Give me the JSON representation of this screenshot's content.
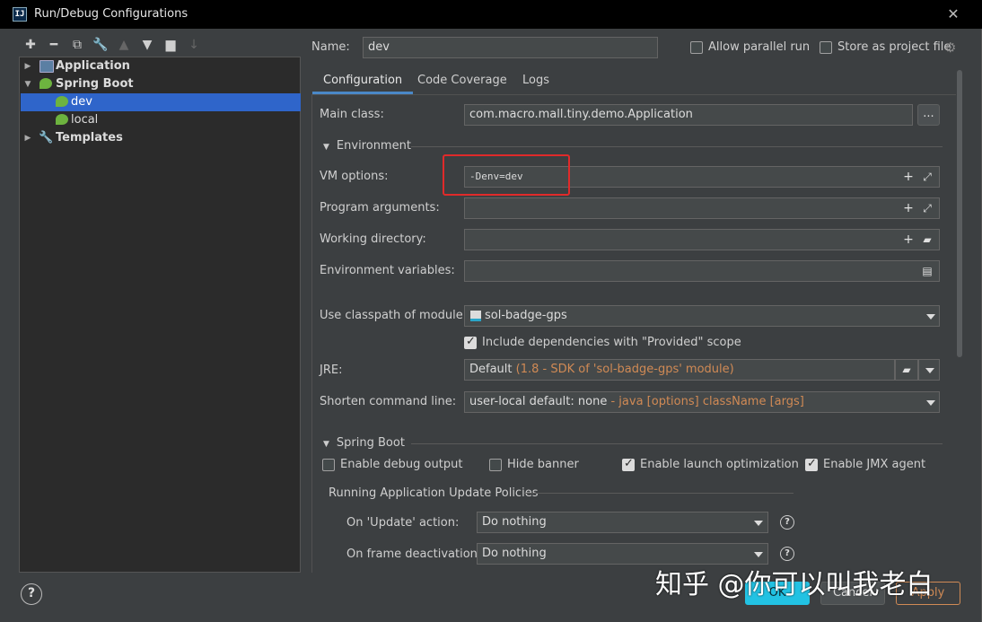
{
  "window": {
    "title": "Run/Debug Configurations",
    "app_icon": "IJ",
    "close_icon": "✕"
  },
  "toolbar": {
    "icons": [
      "add-icon",
      "remove-icon",
      "copy-icon",
      "wrench-icon",
      "move-up-icon",
      "move-down-icon",
      "new-folder-icon",
      "sort-icon"
    ]
  },
  "tree": {
    "items": [
      {
        "label": "Application",
        "level": 0,
        "expanded": false,
        "icon": "application-icon"
      },
      {
        "label": "Spring Boot",
        "level": 0,
        "expanded": true,
        "icon": "spring-boot-icon"
      },
      {
        "label": "dev",
        "level": 1,
        "selected": true,
        "icon": "spring-boot-icon"
      },
      {
        "label": "local",
        "level": 1,
        "icon": "spring-boot-icon"
      },
      {
        "label": "Templates",
        "level": 0,
        "expanded": false,
        "icon": "wrench-icon"
      }
    ]
  },
  "header": {
    "name_label": "Name:",
    "name_value": "dev",
    "allow_parallel_label": "Allow parallel run",
    "allow_parallel_checked": false,
    "store_label": "Store as project file",
    "store_checked": false
  },
  "tabs": [
    {
      "label": "Configuration",
      "active": true
    },
    {
      "label": "Code Coverage",
      "active": false
    },
    {
      "label": "Logs",
      "active": false
    }
  ],
  "config": {
    "main_class_label": "Main class:",
    "main_class_value": "com.macro.mall.tiny.demo.Application",
    "browse_label": "...",
    "environment_section": "Environment",
    "vm_options_label": "VM options:",
    "vm_options_value": "-Denv=dev",
    "program_args_label": "Program arguments:",
    "program_args_value": "",
    "working_dir_label": "Working directory:",
    "working_dir_value": "",
    "env_vars_label": "Environment variables:",
    "env_vars_value": "",
    "classpath_label": "Use classpath of module:",
    "classpath_value": "sol-badge-gps",
    "include_deps_label": "Include dependencies with \"Provided\" scope",
    "include_deps_checked": true,
    "jre_label": "JRE:",
    "jre_value_main": "Default",
    "jre_value_detail": "(1.8 - SDK of 'sol-badge-gps' module)",
    "shorten_label": "Shorten command line:",
    "shorten_value_main": "user-local default: none",
    "shorten_value_detail": "- java [options] className [args]"
  },
  "spring_boot": {
    "section": "Spring Boot",
    "debug_output_label": "Enable debug output",
    "debug_output_checked": false,
    "hide_banner_label": "Hide banner",
    "hide_banner_checked": false,
    "launch_opt_label": "Enable launch optimization",
    "launch_opt_checked": true,
    "jmx_label": "Enable JMX agent",
    "jmx_checked": true,
    "policies_section": "Running Application Update Policies",
    "update_action_label": "On 'Update' action:",
    "update_action_value": "Do nothing",
    "frame_deactivation_label": "On frame deactivation:",
    "frame_deactivation_value": "Do nothing"
  },
  "buttons": {
    "ok": "OK",
    "cancel": "Cancel",
    "apply": "Apply",
    "help": "?"
  },
  "watermark": "知乎 @你可以叫我老白",
  "colors": {
    "selection": "#2f65ca",
    "accent_tab": "#4a88c7",
    "highlight_box": "#e02a2a",
    "orange_text": "#d08a55",
    "primary_button": "#22c2e3"
  }
}
